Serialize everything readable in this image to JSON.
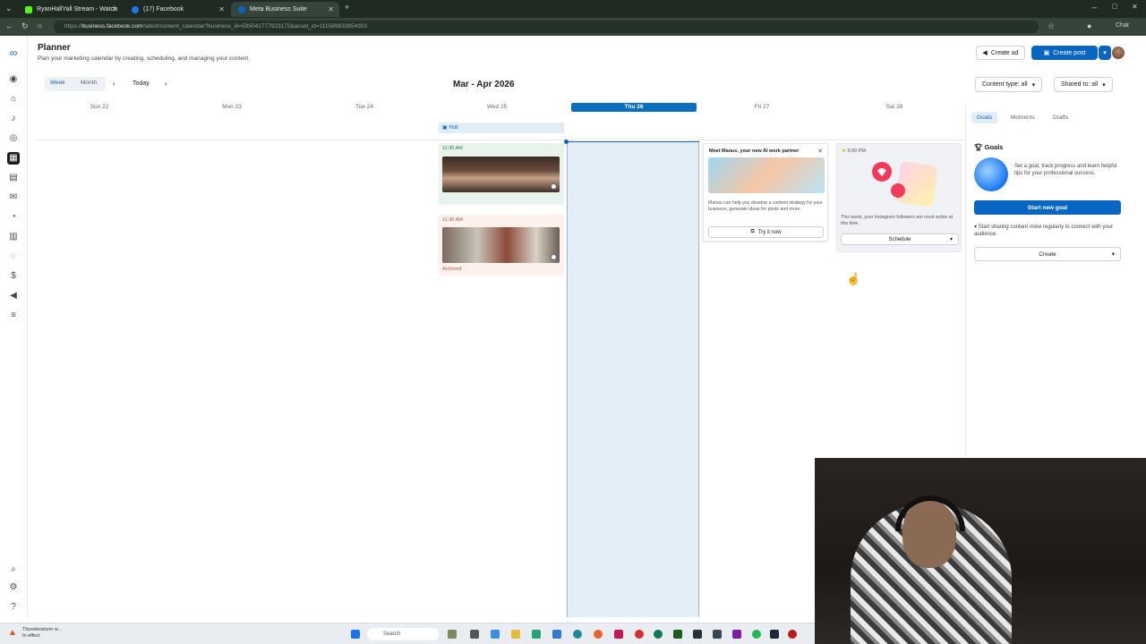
{
  "browser": {
    "tabs": [
      {
        "title": "RyanHallYall Stream - Watch"
      },
      {
        "title": "(17) Facebook"
      },
      {
        "title": "Meta Business Suite"
      }
    ],
    "url_prefix": "https://",
    "url_host": "business.facebook.com",
    "url_path": "/latest/content_calendar?business_id=595041777923172&asset_id=111589833654303",
    "profile_label": "Chat"
  },
  "header": {
    "title": "Planner",
    "subtitle": "Plan your marketing calendar by creating, scheduling, and managing your content.",
    "create_ad": "Create ad",
    "create_post": "Create post"
  },
  "toolbar": {
    "week": "Week",
    "month": "Month",
    "today": "Today",
    "range_title": "Mar - Apr 2026",
    "content_type": "Content type: all",
    "shared_to": "Shared to: all"
  },
  "calendar": {
    "days": [
      "Sun 22",
      "Mon 23",
      "Tue 24",
      "Wed 25",
      "Thu 26",
      "Fri 27",
      "Sat 28"
    ],
    "today_index": 4,
    "holiday": "Holi",
    "posts": [
      {
        "time": "11:30 AM",
        "status": ""
      },
      {
        "time": "11:30 AM",
        "status": "Archived"
      }
    ]
  },
  "ai_card": {
    "title": "Meet Manus, your new AI work partner",
    "description": "Manus can help you develop a content strategy for your business, generate ideas for posts and more.",
    "button": "Try it now"
  },
  "ig_card": {
    "time": "5:00 PM",
    "description": "This week, your Instagram followers are most active at this time.",
    "button": "Schedule"
  },
  "right_panel": {
    "tabs": [
      "Goals",
      "Moments",
      "Drafts"
    ],
    "heading": "Goals",
    "description": "Set a goal, track progress and learn helpful tips for your professional success.",
    "new_goal": "Start new goal",
    "tip": "Start sharing content more regularly to connect with your audience.",
    "create": "Create"
  },
  "taskbar": {
    "weather_title": "Thunderstorm w...",
    "weather_sub": "In effect",
    "search": "Search"
  },
  "colors": {
    "accent": "#0866c2",
    "today_header": "#0b6fc1",
    "today_column": "#e4eef8"
  }
}
